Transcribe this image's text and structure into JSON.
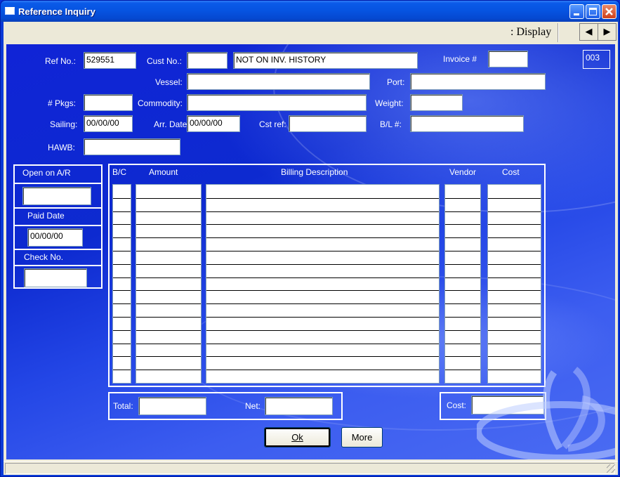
{
  "window": {
    "title": "Reference Inquiry"
  },
  "toolbar": {
    "display_label": ": Display",
    "prev_glyph": "◀",
    "next_glyph": "▶"
  },
  "header": {
    "ref_no_label": "Ref No.:",
    "ref_no_value": "529551",
    "cust_no_label": "Cust No.:",
    "cust_no_value": "",
    "cust_name_value": "NOT ON INV. HISTORY",
    "invoice_label": "Invoice #",
    "invoice_value": "",
    "code_value": "003",
    "vessel_label": "Vessel:",
    "vessel_value": "",
    "port_label": "Port:",
    "port_value": "",
    "pkgs_label": "# Pkgs:",
    "pkgs_value": "",
    "commodity_label": "Commodity:",
    "commodity_value": "",
    "weight_label": "Weight:",
    "weight_value": "",
    "sailing_label": "Sailing:",
    "sailing_value": "00/00/00",
    "arr_date_label": "Arr. Date:",
    "arr_date_value": "00/00/00",
    "cst_ref_label": "Cst ref:",
    "cst_ref_value": "",
    "bl_label": "B/L #:",
    "bl_value": "",
    "hawb_label": "HAWB:",
    "hawb_value": ""
  },
  "side": {
    "open_ar_label": "Open on A/R",
    "open_ar_value": "",
    "paid_date_label": "Paid Date",
    "paid_date_value": "00/00/00",
    "check_no_label": "Check No.",
    "check_no_value": ""
  },
  "grid": {
    "columns": [
      "B/C",
      "Amount",
      "Billing Description",
      "Vendor",
      "Cost"
    ],
    "row_count": 15
  },
  "totals": {
    "total_label": "Total:",
    "total_value": "",
    "net_label": "Net:",
    "net_value": "",
    "cost_label": "Cost:",
    "cost_value": ""
  },
  "buttons": {
    "ok_label": "Ok",
    "more_label": "More"
  },
  "colors": {
    "panel_blue": "#1024d6",
    "titlebar_blue": "#0653e0",
    "chrome": "#ece9d8"
  }
}
